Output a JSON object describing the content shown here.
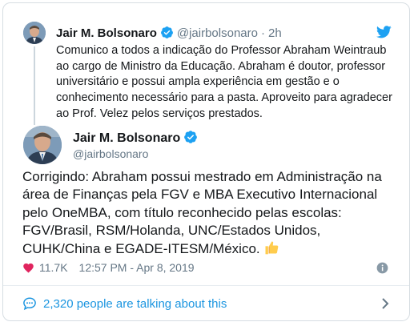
{
  "parent_tweet": {
    "name": "Jair M. Bolsonaro",
    "handle": "@jairbolsonaro",
    "separator": "·",
    "time": "2h",
    "text": "Comunico a todos a indicação do Professor Abraham Weintraub ao cargo de Ministro da Educação. Abraham é doutor, professor universitário e possui ampla experiência em gestão e o conhecimento necessário para a pasta. Aproveito para agradecer ao Prof. Velez pelos serviços prestados."
  },
  "main_tweet": {
    "name": "Jair M. Bolsonaro",
    "handle": "@jairbolsonaro",
    "text": "Corrigindo: Abraham possui mestrado em Administração na área de Finanças pela FGV e MBA Executivo Internacional pelo OneMBA, com título reconhecido pelas escolas: FGV/Brasil, RSM/Holanda, UNC/Estados Unidos, CUHK/China e EGADE-ITESM/México.",
    "likes": "11.7K",
    "timestamp": "12:57 PM - Apr 8, 2019"
  },
  "footer": {
    "talking_label": "2,320 people are talking about this"
  },
  "colors": {
    "verified": "#1da1f2",
    "link": "#1b95e0",
    "muted": "#657786",
    "heart": "#e0245e"
  },
  "icons": [
    "verified-badge-icon",
    "twitter-bird-icon",
    "heart-icon",
    "info-icon",
    "speech-bubbles-icon",
    "chevron-right-icon",
    "thumbs-up-emoji-icon"
  ]
}
